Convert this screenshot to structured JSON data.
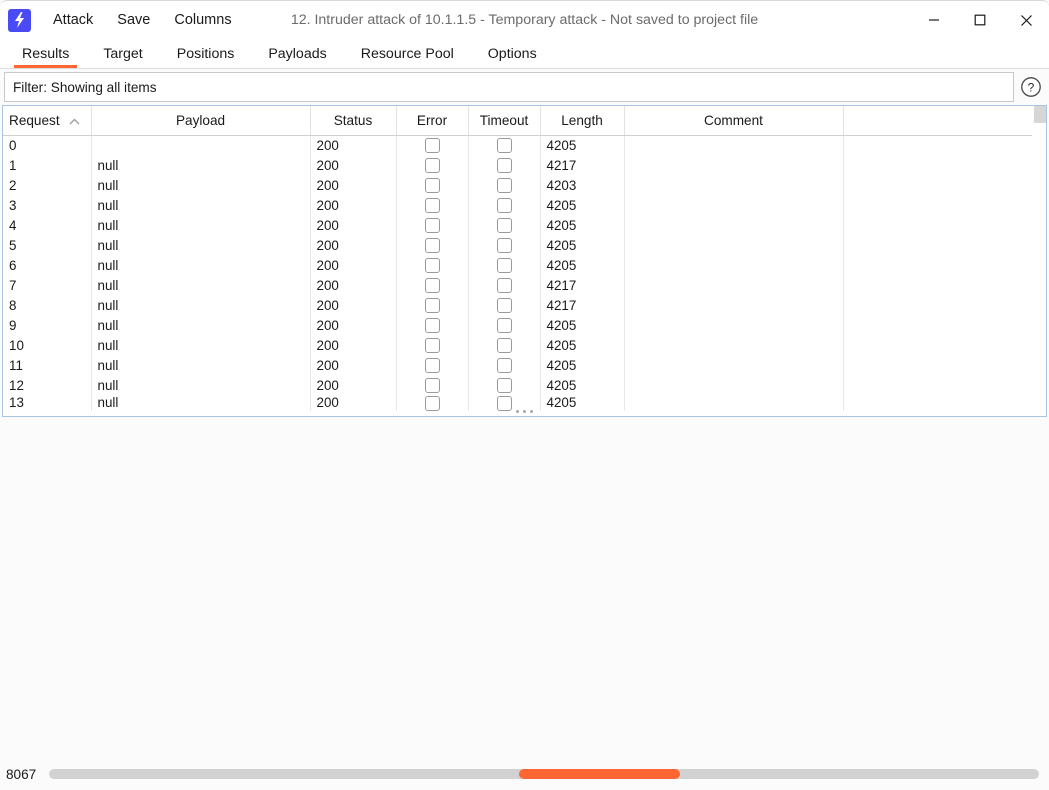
{
  "window": {
    "title": "12. Intruder attack of 10.1.1.5 - Temporary attack - Not saved to project file",
    "logo_icon": "lightning-bolt-icon",
    "minimize_label": "minimize-icon",
    "maximize_label": "maximize-icon",
    "close_label": "close-icon",
    "accent_color": "#ff6633",
    "logo_color": "#4b4bf5"
  },
  "menubar": {
    "items": [
      {
        "label": "Attack"
      },
      {
        "label": "Save"
      },
      {
        "label": "Columns"
      }
    ]
  },
  "tabs": {
    "active": "Results",
    "items": [
      {
        "label": "Results"
      },
      {
        "label": "Target"
      },
      {
        "label": "Positions"
      },
      {
        "label": "Payloads"
      },
      {
        "label": "Resource Pool"
      },
      {
        "label": "Options"
      }
    ]
  },
  "filter": {
    "text": "Filter: Showing all items",
    "help_icon": "question-mark-icon"
  },
  "table": {
    "columns": [
      {
        "label": "Request",
        "sorted": "ascending"
      },
      {
        "label": "Payload"
      },
      {
        "label": "Status"
      },
      {
        "label": "Error"
      },
      {
        "label": "Timeout"
      },
      {
        "label": "Length"
      },
      {
        "label": "Comment"
      },
      {
        "label": ""
      }
    ],
    "rows": [
      {
        "request": "0",
        "payload": "",
        "status": "200",
        "error": false,
        "timeout": false,
        "length": "4205",
        "comment": ""
      },
      {
        "request": "1",
        "payload": "null",
        "status": "200",
        "error": false,
        "timeout": false,
        "length": "4217",
        "comment": ""
      },
      {
        "request": "2",
        "payload": "null",
        "status": "200",
        "error": false,
        "timeout": false,
        "length": "4203",
        "comment": ""
      },
      {
        "request": "3",
        "payload": "null",
        "status": "200",
        "error": false,
        "timeout": false,
        "length": "4205",
        "comment": ""
      },
      {
        "request": "4",
        "payload": "null",
        "status": "200",
        "error": false,
        "timeout": false,
        "length": "4205",
        "comment": ""
      },
      {
        "request": "5",
        "payload": "null",
        "status": "200",
        "error": false,
        "timeout": false,
        "length": "4205",
        "comment": ""
      },
      {
        "request": "6",
        "payload": "null",
        "status": "200",
        "error": false,
        "timeout": false,
        "length": "4205",
        "comment": ""
      },
      {
        "request": "7",
        "payload": "null",
        "status": "200",
        "error": false,
        "timeout": false,
        "length": "4217",
        "comment": ""
      },
      {
        "request": "8",
        "payload": "null",
        "status": "200",
        "error": false,
        "timeout": false,
        "length": "4217",
        "comment": ""
      },
      {
        "request": "9",
        "payload": "null",
        "status": "200",
        "error": false,
        "timeout": false,
        "length": "4205",
        "comment": ""
      },
      {
        "request": "10",
        "payload": "null",
        "status": "200",
        "error": false,
        "timeout": false,
        "length": "4205",
        "comment": ""
      },
      {
        "request": "11",
        "payload": "null",
        "status": "200",
        "error": false,
        "timeout": false,
        "length": "4205",
        "comment": ""
      },
      {
        "request": "12",
        "payload": "null",
        "status": "200",
        "error": false,
        "timeout": false,
        "length": "4205",
        "comment": ""
      },
      {
        "request": "13",
        "payload": "null",
        "status": "200",
        "error": false,
        "timeout": false,
        "length": "4205",
        "comment": ""
      }
    ]
  },
  "statusbar": {
    "count": "8067",
    "progress_left_pct": 47.5,
    "progress_width_pct": 16.2
  }
}
